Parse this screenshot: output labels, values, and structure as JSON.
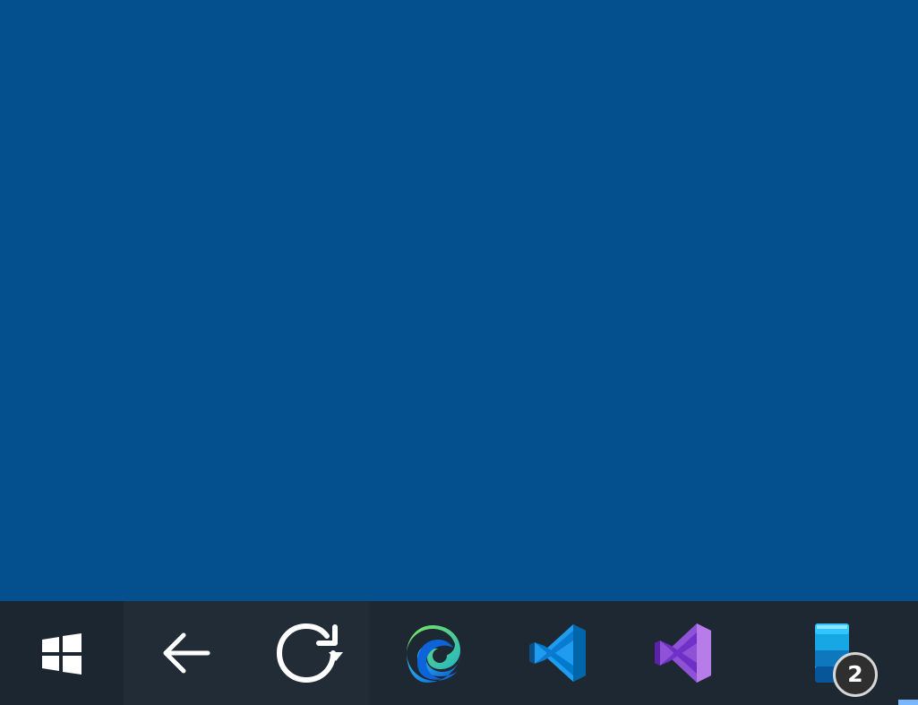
{
  "screen": {
    "desktop_color": "#04508f"
  },
  "taskbar": {
    "background": "#1e2833",
    "items": [
      {
        "name": "windows-start-button",
        "icon": "windows-logo"
      },
      {
        "name": "back-button",
        "icon": "left-arrow"
      },
      {
        "name": "refresh-button",
        "icon": "refresh-arrow"
      },
      {
        "name": "microsoft-edge-button",
        "icon": "edge-logo"
      },
      {
        "name": "visual-studio-code-button",
        "icon": "vs-code-logo"
      },
      {
        "name": "visual-studio-button",
        "icon": "visual-studio-logo"
      },
      {
        "name": "phone-link-button",
        "icon": "phone-icon"
      }
    ],
    "phone_badge": "2"
  }
}
